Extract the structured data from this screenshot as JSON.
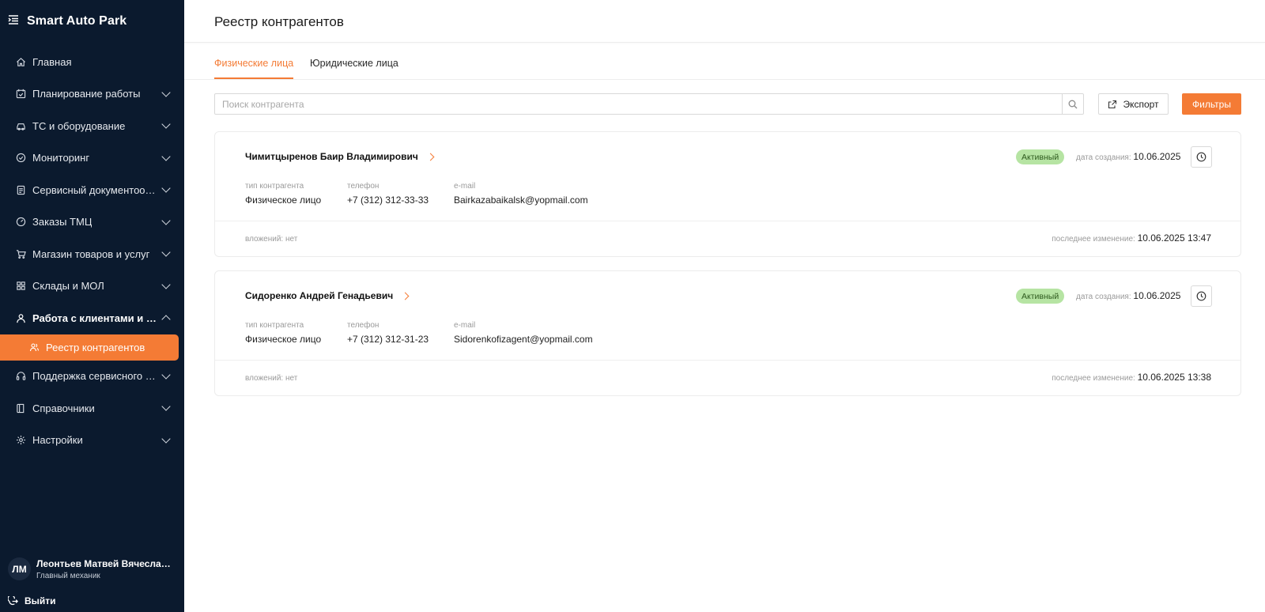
{
  "app": {
    "brand": "Smart Auto Park"
  },
  "sidebar": {
    "items": [
      {
        "label": "Главная",
        "icon": "home-icon"
      },
      {
        "label": "Планирование работы",
        "icon": "calendar-check-icon"
      },
      {
        "label": "ТС и оборудование",
        "icon": "car-icon"
      },
      {
        "label": "Мониторинг",
        "icon": "check-circle-icon"
      },
      {
        "label": "Сервисный документооборот",
        "icon": "document-icon"
      },
      {
        "label": "Заказы ТМЦ",
        "icon": "gauge-icon"
      },
      {
        "label": "Магазин товаров и услуг",
        "icon": "cart-icon"
      },
      {
        "label": "Склады и МОЛ",
        "icon": "warehouse-icon"
      },
      {
        "label": "Работа с клиентами и качеством",
        "icon": "user-icon",
        "open": true
      },
      {
        "label": "Поддержка сервисного персонала",
        "icon": "headset-icon"
      },
      {
        "label": "Справочники",
        "icon": "book-icon"
      },
      {
        "label": "Настройки",
        "icon": "gear-icon"
      }
    ],
    "active_subitem": {
      "label": "Реестр контрагентов",
      "icon": "contacts-icon"
    },
    "user": {
      "initials": "ЛМ",
      "name": "Леонтьев Матвей Вячеславович",
      "role": "Главный механик"
    },
    "logout_label": "Выйти"
  },
  "header": {
    "title": "Реестр контрагентов"
  },
  "tabs": [
    {
      "label": "Физические лица",
      "active": true
    },
    {
      "label": "Юридические лица",
      "active": false
    }
  ],
  "toolbar": {
    "search_placeholder": "Поиск контрагента",
    "export_label": "Экспорт",
    "filters_label": "Фильтры"
  },
  "labels": {
    "type": "тип контрагента",
    "phone": "телефон",
    "email": "e-mail",
    "created": "дата создания:",
    "modified": "последнее изменение:"
  },
  "colors": {
    "accent": "#f47b35",
    "sidebar_bg": "#0b1a2e",
    "status_bg": "#b6e4a3"
  },
  "counterparties": [
    {
      "name": "Чимитцыренов Баир Владимирович",
      "status": "Активный",
      "created": "10.06.2025",
      "type": "Физическое лицо",
      "phone": "+7 (312) 312-33-33",
      "email": "Bairkazabaikalsk@yopmail.com",
      "attachments": "вложений: нет",
      "modified": "10.06.2025 13:47"
    },
    {
      "name": "Сидоренко Андрей Генадьевич",
      "status": "Активный",
      "created": "10.06.2025",
      "type": "Физическое лицо",
      "phone": "+7 (312) 312-31-23",
      "email": "Sidorenkofizagent@yopmail.com",
      "attachments": "вложений: нет",
      "modified": "10.06.2025 13:38"
    }
  ]
}
